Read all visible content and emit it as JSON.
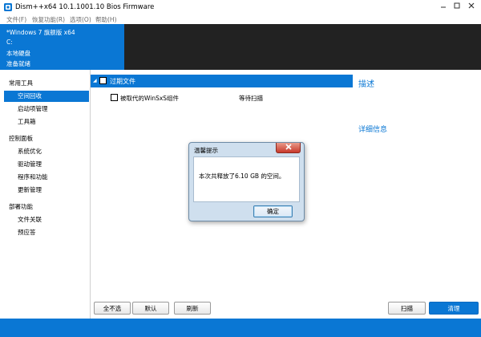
{
  "window": {
    "title": "Dism++x64 10.1.1001.10 Bios Firmware",
    "icon": "dism-app-icon",
    "controls": {
      "minimize": "minimize-icon",
      "maximize": "maximize-icon",
      "close": "close-icon"
    }
  },
  "menu": [
    {
      "label": "文件(F)"
    },
    {
      "label": "恢复功能(R)"
    },
    {
      "label": "选项(O)"
    },
    {
      "label": "帮助(H)"
    }
  ],
  "info": {
    "os": "*Windows 7 旗舰版 x64",
    "drive": "C:",
    "disk": "本地硬盘",
    "status": "准备就绪"
  },
  "sidebar": {
    "categories": [
      {
        "label": "常用工具",
        "items": [
          {
            "label": "空间回收",
            "selected": true
          },
          {
            "label": "启动项管理"
          },
          {
            "label": "工具箱"
          }
        ]
      },
      {
        "label": "控制面板",
        "items": [
          {
            "label": "系统优化"
          },
          {
            "label": "驱动管理"
          },
          {
            "label": "程序和功能"
          },
          {
            "label": "更新管理"
          }
        ]
      },
      {
        "label": "部署功能",
        "items": [
          {
            "label": "文件关联"
          },
          {
            "label": "预应答"
          }
        ]
      }
    ]
  },
  "main": {
    "group_label": "过期文件",
    "rows": [
      {
        "label": "被取代的WinSxS组件",
        "status": "等待扫描"
      }
    ],
    "description_title": "描述",
    "details_title": "详细信息"
  },
  "buttons": {
    "select_none": "全不选",
    "default": "默认",
    "refresh": "刷新",
    "scan": "扫描",
    "clean": "清理"
  },
  "dialog": {
    "title": "温馨提示",
    "message": "本次共释放了6.10 GB 的空间。",
    "ok": "确定"
  },
  "colors": {
    "accent": "#0a77d4",
    "header_dark": "#222222",
    "dialog_close": "#c8392b"
  }
}
